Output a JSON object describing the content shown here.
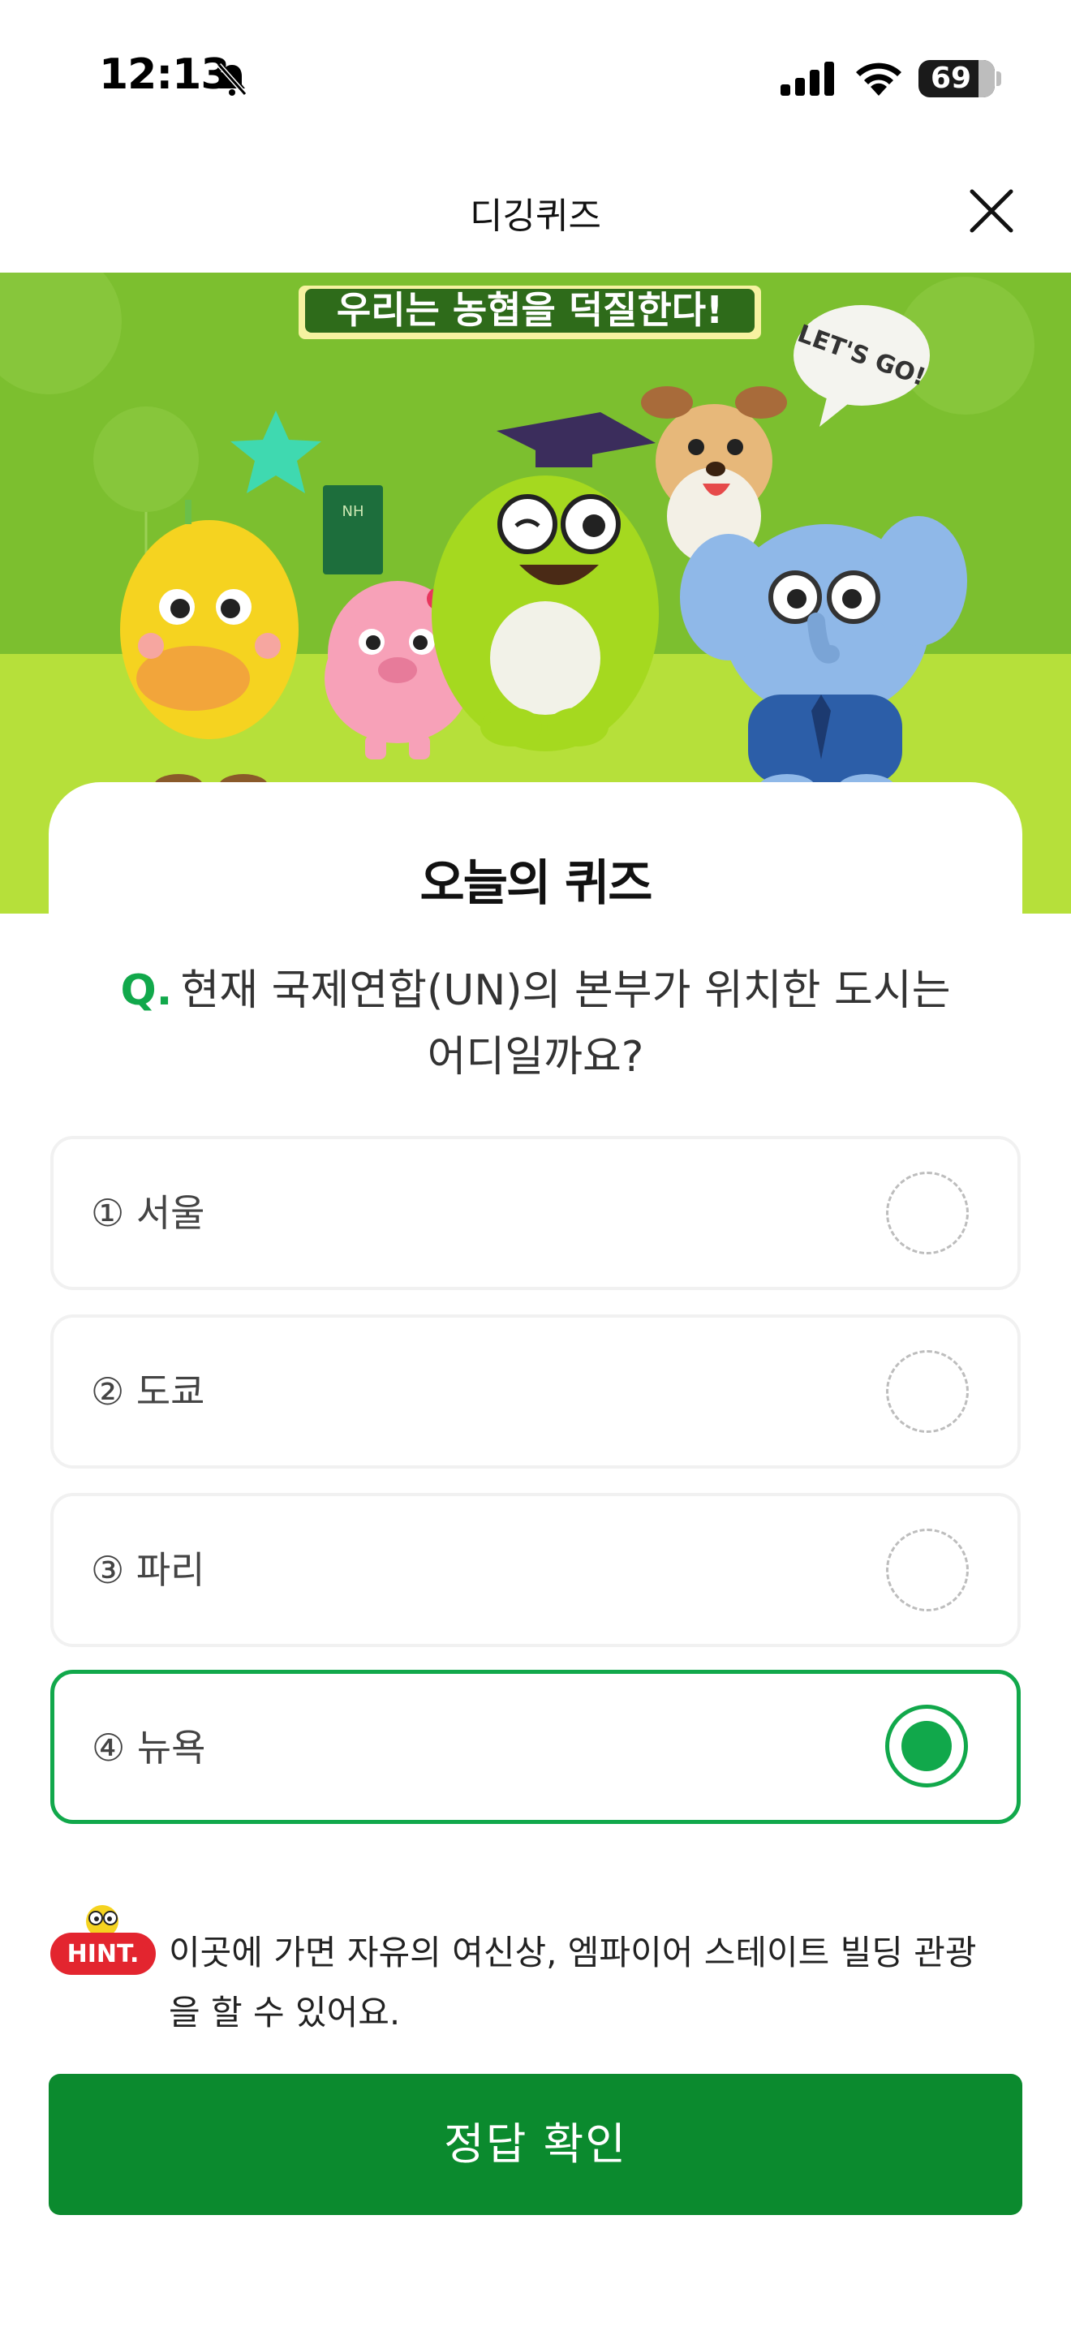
{
  "status_bar": {
    "time": "12:13",
    "battery": "69"
  },
  "header": {
    "title": "디깅퀴즈"
  },
  "banner": {
    "slogan": "우리는 농협을 덕질한다!",
    "speech_bubble": "LET'S GO!",
    "book_text": "NH"
  },
  "quiz": {
    "heading": "오늘의 퀴즈",
    "question_prefix": "Q.",
    "question_line1": "현재 국제연합(UN)의 본부가 위치한 도시는",
    "question_line2": "어디일까요?",
    "options": [
      {
        "label": "① 서울",
        "selected": false
      },
      {
        "label": "② 도쿄",
        "selected": false
      },
      {
        "label": "③ 파리",
        "selected": false
      },
      {
        "label": "④ 뉴욕",
        "selected": true
      }
    ]
  },
  "hint": {
    "badge": "HINT.",
    "line1": "이곳에 가면 자유의 여신상, 엠파이어 스테이트 빌딩 관광",
    "line2": "을 할 수 있어요."
  },
  "submit": {
    "label": "정답 확인"
  },
  "colors": {
    "accent": "#11a84b",
    "button": "#0b8a2e",
    "banner_green": "#b6e03a"
  }
}
